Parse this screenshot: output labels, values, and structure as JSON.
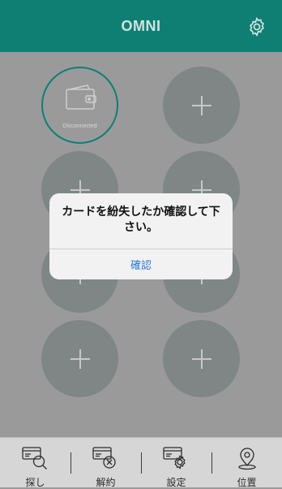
{
  "header": {
    "title": "OMNI",
    "settings_icon": "gear-icon"
  },
  "slots": {
    "active": {
      "status": "Disconnected",
      "icon": "wallet-icon"
    },
    "empty_icon": "plus-icon"
  },
  "dialog": {
    "message": "カードを紛失したか確認して下さい。",
    "confirm": "確認"
  },
  "tabbar": {
    "items": [
      {
        "label": "探し",
        "icon": "card-search-icon"
      },
      {
        "label": "解約",
        "icon": "card-cancel-icon"
      },
      {
        "label": "設定",
        "icon": "card-settings-icon"
      },
      {
        "label": "位置",
        "icon": "location-pin-icon"
      }
    ]
  },
  "colors": {
    "header": "#0f7f74",
    "accent": "#2a7bd1",
    "slot": "#7f8685"
  }
}
